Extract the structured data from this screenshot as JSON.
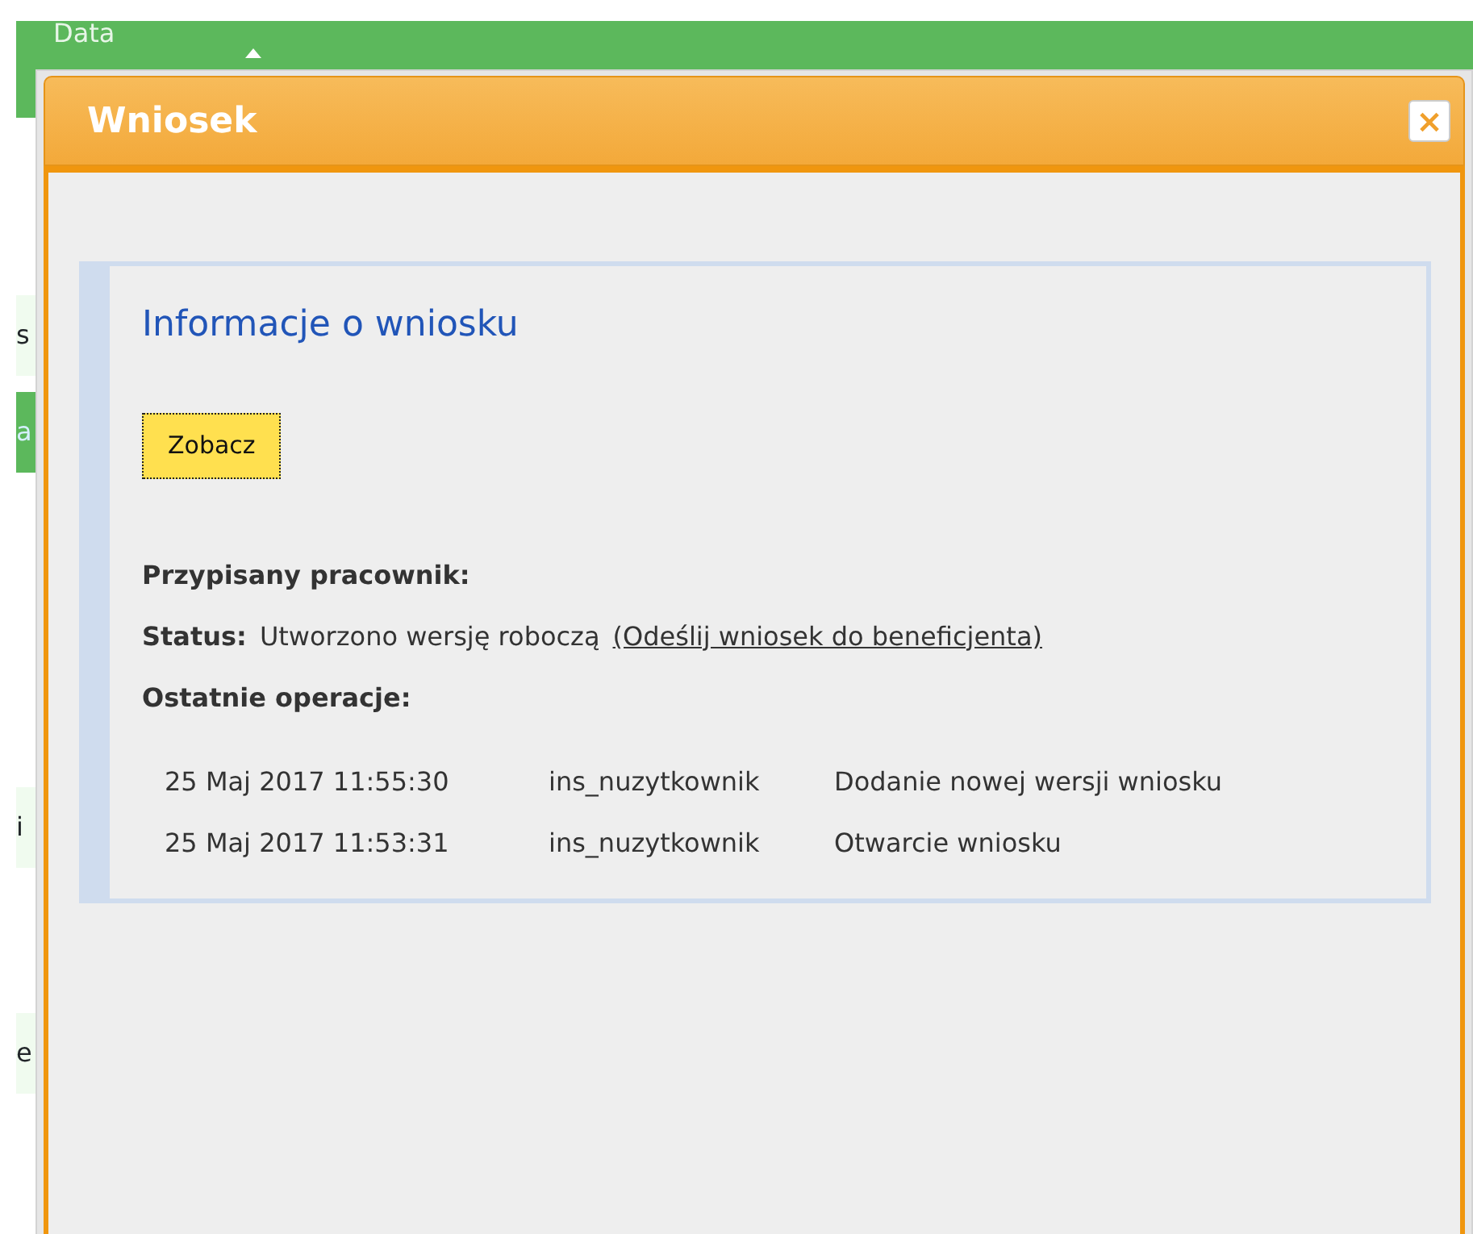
{
  "background": {
    "header_label": "Data",
    "side_fragments": [
      {
        "text": "s",
        "kind": "plain"
      },
      {
        "text": "a",
        "kind": "green"
      },
      {
        "text": "i",
        "kind": "plain"
      },
      {
        "text": "e",
        "kind": "plain"
      }
    ]
  },
  "dialog": {
    "title": "Wniosek",
    "close_label": "×"
  },
  "panel": {
    "heading": "Informacje o wniosku",
    "view_button": "Zobacz",
    "assigned_label": "Przypisany pracownik:",
    "status_label": "Status:",
    "status_value": "Utworzono wersję roboczą",
    "status_link": "(Odeślij wniosek do beneficjenta)",
    "operations_label": "Ostatnie operacje:",
    "operations": [
      {
        "date": "25 Maj 2017 11:55:30",
        "user": "ins_nuzytkownik",
        "action": "Dodanie nowej wersji wniosku"
      },
      {
        "date": "25 Maj 2017 11:53:31",
        "user": "ins_nuzytkownik",
        "action": "Otwarcie wniosku"
      }
    ]
  }
}
